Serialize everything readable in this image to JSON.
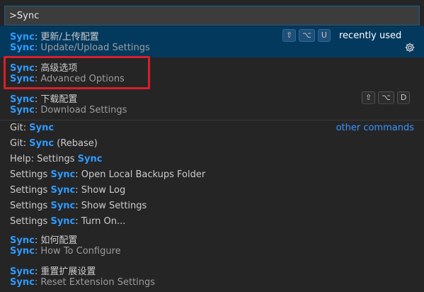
{
  "input": {
    "value": ">Sync"
  },
  "items": [
    {
      "prefix": "Sync",
      "label1": ": 更新/上传配置",
      "label2_prefix": "Sync",
      "label2": ": Update/Upload Settings",
      "keys": [
        "⇧",
        "⌥",
        "U"
      ],
      "tag": "recently used"
    },
    {
      "prefix": "Sync",
      "label1": ": 高级选项",
      "label2_prefix": "Sync",
      "label2": ": Advanced Options"
    },
    {
      "prefix": "Sync",
      "label1": ": 下载配置",
      "label2_prefix": "Sync",
      "label2": ": Download Settings",
      "keys": [
        "⇧",
        "⌥",
        "D"
      ]
    },
    {
      "before": "Git: ",
      "hl": "Sync",
      "after": "",
      "tag": "other commands"
    },
    {
      "before": "Git: ",
      "hl": "Sync",
      "after": " (Rebase)"
    },
    {
      "before": "Help: Settings ",
      "hl": "Sync",
      "after": ""
    },
    {
      "before": "Settings ",
      "hl": "Sync",
      "after": ": Open Local Backups Folder"
    },
    {
      "before": "Settings ",
      "hl": "Sync",
      "after": ": Show Log"
    },
    {
      "before": "Settings ",
      "hl": "Sync",
      "after": ": Show Settings"
    },
    {
      "before": "Settings ",
      "hl": "Sync",
      "after": ": Turn On..."
    },
    {
      "prefix": "Sync",
      "label1": ": 如何配置",
      "label2_prefix": "Sync",
      "label2": ": How To Configure"
    },
    {
      "prefix": "Sync",
      "label1": ": 重置扩展设置",
      "label2_prefix": "Sync",
      "label2": ": Reset Extension Settings"
    }
  ]
}
